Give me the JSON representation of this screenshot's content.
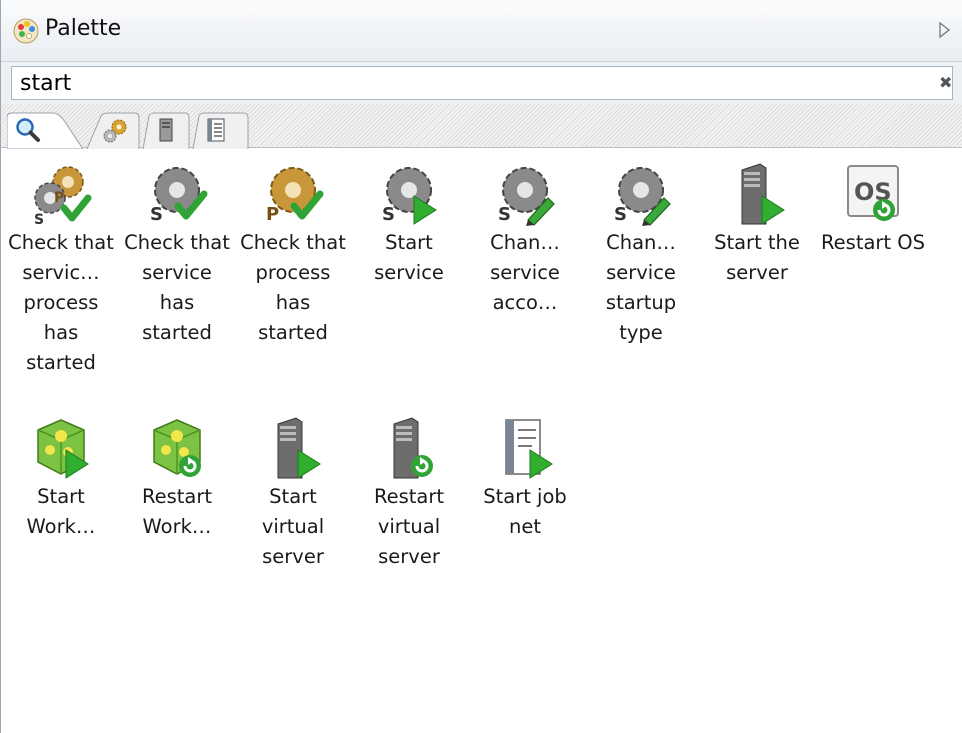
{
  "panel": {
    "title": "Palette",
    "title_icon": "palette-icon",
    "collapse_icon": "collapse-triangle-icon"
  },
  "search": {
    "value": "start",
    "clear_icon": "clear-icon",
    "clear_glyph": "✖"
  },
  "tabs": [
    {
      "id": "search",
      "icon": "magnifier-icon"
    },
    {
      "id": "jobs",
      "icon": "gears-icon"
    },
    {
      "id": "servers",
      "icon": "server-icon"
    },
    {
      "id": "jobnets",
      "icon": "document-icon"
    }
  ],
  "items": [
    {
      "label": "Check that servic… process has started",
      "icon": "service-process-check-icon"
    },
    {
      "label": "Check that service has started",
      "icon": "service-check-icon"
    },
    {
      "label": "Check that process has started",
      "icon": "process-check-icon"
    },
    {
      "label": "Start service",
      "icon": "service-start-icon"
    },
    {
      "label": "Chan… service acco…",
      "icon": "service-account-edit-icon"
    },
    {
      "label": "Chan… service startup type",
      "icon": "service-startup-edit-icon"
    },
    {
      "label": "Start the server",
      "icon": "server-start-icon"
    },
    {
      "label": "Restart OS",
      "icon": "os-restart-icon"
    },
    {
      "label": "Start Work…",
      "icon": "workload-start-icon"
    },
    {
      "label": "Restart Work…",
      "icon": "workload-restart-icon"
    },
    {
      "label": "Start virtual server",
      "icon": "virtual-server-start-icon"
    },
    {
      "label": "Restart virtual server",
      "icon": "virtual-server-restart-icon"
    },
    {
      "label": "Start job net",
      "icon": "jobnet-start-icon"
    }
  ],
  "colors": {
    "gear_gray": "#8a8a8a",
    "gear_gold": "#c89a3a",
    "check_green": "#2fa336",
    "play_green": "#2fae2f",
    "cube_green": "#7cc243",
    "server_gray": "#6d6d6d"
  }
}
